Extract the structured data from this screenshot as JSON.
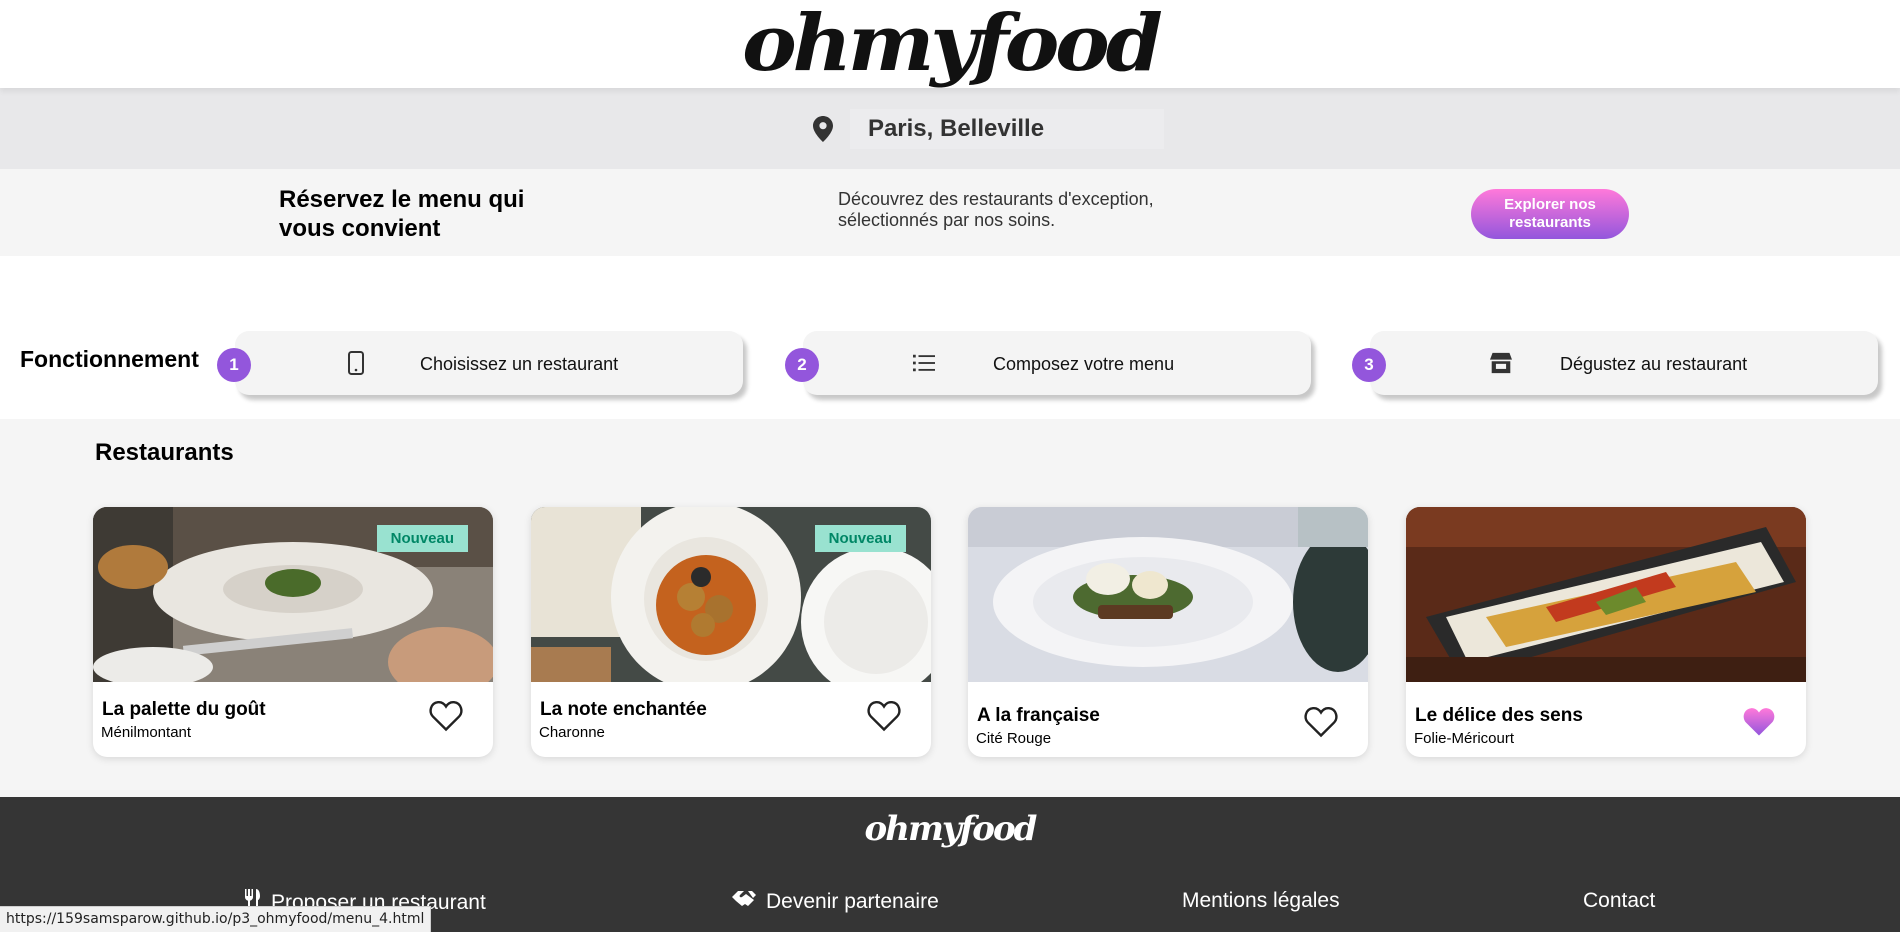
{
  "header": {
    "logo": "ohmyfood"
  },
  "location": {
    "icon": "map-pin-icon",
    "text": "Paris, Belleville"
  },
  "banner": {
    "title": "Réservez le menu qui vous convient",
    "description": "Découvrez des restaurants d'exception, sélectionnés par nos soins.",
    "button_label": "Explorer nos restaurants",
    "button_gradient": [
      "#ff79da",
      "#9356dc"
    ]
  },
  "how_it_works": {
    "title": "Fonctionnement",
    "steps": [
      {
        "number": "1",
        "icon": "smartphone-icon",
        "label": "Choisissez un restaurant"
      },
      {
        "number": "2",
        "icon": "list-icon",
        "label": "Composez votre menu"
      },
      {
        "number": "3",
        "icon": "store-icon",
        "label": "Dégustez au restaurant"
      }
    ]
  },
  "restaurants": {
    "title": "Restaurants",
    "cards": [
      {
        "name": "La palette du goût",
        "area": "Ménilmontant",
        "badge": "Nouveau",
        "liked": false
      },
      {
        "name": "La note enchantée",
        "area": "Charonne",
        "badge": "Nouveau",
        "liked": false
      },
      {
        "name": "A la française",
        "area": "Cité Rouge",
        "badge": "",
        "liked": false
      },
      {
        "name": "Le délice des sens",
        "area": "Folie-Méricourt",
        "badge": "",
        "liked": true
      }
    ]
  },
  "footer": {
    "logo": "ohmyfood",
    "links": [
      {
        "icon": "utensils-icon",
        "label": "Proposer un restaurant"
      },
      {
        "icon": "handshake-icon",
        "label": "Devenir partenaire"
      },
      {
        "icon": "",
        "label": "Mentions légales"
      },
      {
        "icon": "",
        "label": "Contact"
      }
    ]
  },
  "status_bar": {
    "url": "https://159samsparow.github.io/p3_ohmyfood/menu_4.html"
  },
  "colors": {
    "accent": "#9356dc",
    "accent_pink": "#ff79da",
    "badge_bg": "#99e2d0",
    "badge_text": "#008766",
    "footer_bg": "#353535"
  }
}
